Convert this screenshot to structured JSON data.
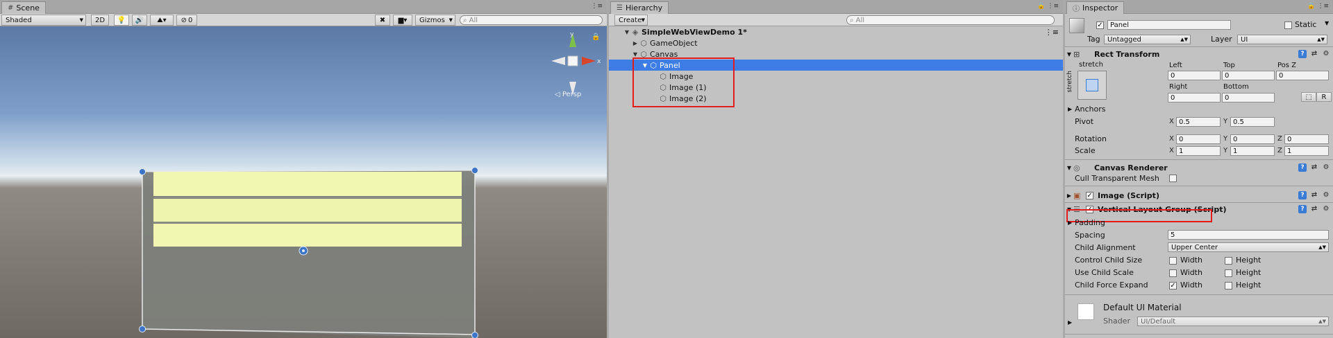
{
  "scene": {
    "tab": "Scene",
    "shading_mode": "Shaded",
    "mode_2d": "2D",
    "hidden_count": "0",
    "gizmos": "Gizmos",
    "search_placeholder": "All",
    "persp_label": "Persp",
    "gizmo_axis_y": "y",
    "gizmo_axis_x": "x"
  },
  "hierarchy": {
    "tab": "Hierarchy",
    "create": "Create",
    "search_placeholder": "All",
    "rows": {
      "root": "SimpleWebViewDemo 1*",
      "gameobject": "GameObject",
      "canvas": "Canvas",
      "panel": "Panel",
      "image0": "Image",
      "image1": "Image (1)",
      "image2": "Image (2)"
    }
  },
  "inspector": {
    "tab": "Inspector",
    "object_name": "Panel",
    "static_label": "Static",
    "tag_label": "Tag",
    "tag_value": "Untagged",
    "layer_label": "Layer",
    "layer_value": "UI",
    "rect_transform": {
      "title": "Rect Transform",
      "stretch_top": "stretch",
      "stretch_side": "stretch",
      "left_label": "Left",
      "left": "0",
      "top_label": "Top",
      "top": "0",
      "posz_label": "Pos Z",
      "posz": "0",
      "right_label": "Right",
      "right": "0",
      "bottom_label": "Bottom",
      "bottom": "0",
      "r_button": "R",
      "anchors": "Anchors",
      "pivot_label": "Pivot",
      "pivot_x": "0.5",
      "pivot_y": "0.5",
      "rotation_label": "Rotation",
      "rot_x": "0",
      "rot_y": "0",
      "rot_z": "0",
      "scale_label": "Scale",
      "scale_x": "1",
      "scale_y": "1",
      "scale_z": "1",
      "x": "X",
      "y": "Y",
      "z": "Z"
    },
    "canvas_renderer": {
      "title": "Canvas Renderer",
      "cull_label": "Cull Transparent Mesh"
    },
    "image_script": {
      "title": "Image (Script)"
    },
    "vlg": {
      "title": "Vertical Layout Group (Script)",
      "padding": "Padding",
      "spacing_label": "Spacing",
      "spacing": "5",
      "child_alignment_label": "Child Alignment",
      "child_alignment": "Upper Center",
      "control_child_size": "Control Child Size",
      "use_child_scale": "Use Child Scale",
      "child_force_expand": "Child Force Expand",
      "width": "Width",
      "height": "Height",
      "force_expand_width_checked": true
    },
    "material": {
      "name": "Default UI Material",
      "shader_label": "Shader",
      "shader_value": "UI/Default"
    }
  },
  "colors": {
    "selection": "#3e7de5",
    "highlight_box": "#e21b1b",
    "panel_yellow": "#f1f6b0"
  }
}
